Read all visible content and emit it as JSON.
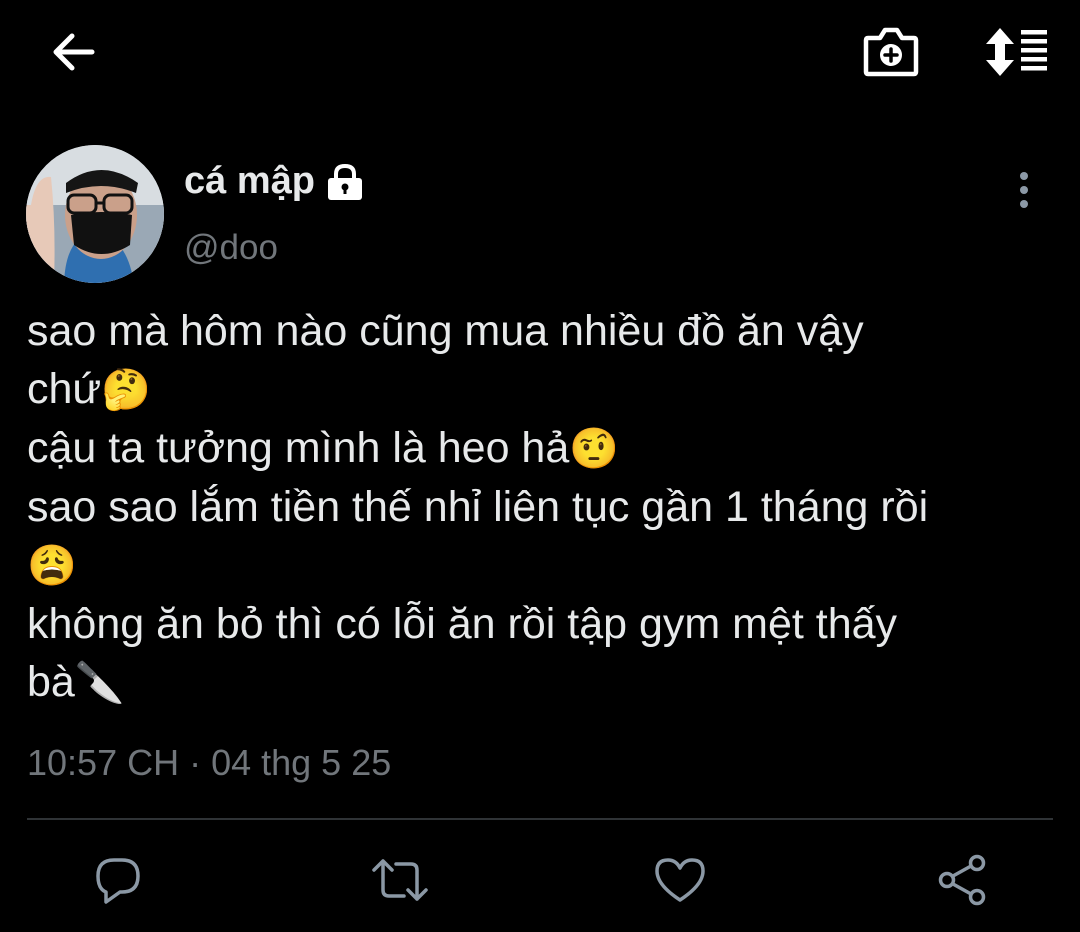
{
  "header": {
    "back_icon": "arrow-left-icon",
    "camera_icon": "camera-plus-icon",
    "sort_icon": "sort-list-icon"
  },
  "tweet": {
    "author": {
      "name": "cá mập",
      "handle": "@doo",
      "locked_icon": "lock-icon"
    },
    "lines": [
      "sao mà hôm nào cũng mua nhiều đồ ăn vậy",
      "chứ",
      "cậu ta tưởng mình là heo hả",
      "sao sao lắm tiền thế nhỉ liên tục gần 1 tháng rồi",
      "",
      "không ăn bỏ thì có lỗi ăn rồi tập gym mệt thấy",
      "bà"
    ],
    "emojis": {
      "thinking": "🤔",
      "raised_eyebrow": "🤨",
      "weary": "😩",
      "knife": "🔪"
    },
    "time": "10:57 CH",
    "separator": "·",
    "date": "04 thg 5 25"
  },
  "actions": [
    "reply-icon",
    "retweet-icon",
    "like-icon",
    "share-icon"
  ],
  "colors": {
    "background": "#000000",
    "text": "#e7e9ea",
    "secondary": "#71767b",
    "icon": "#8b98a5",
    "divider": "#2f3336"
  }
}
